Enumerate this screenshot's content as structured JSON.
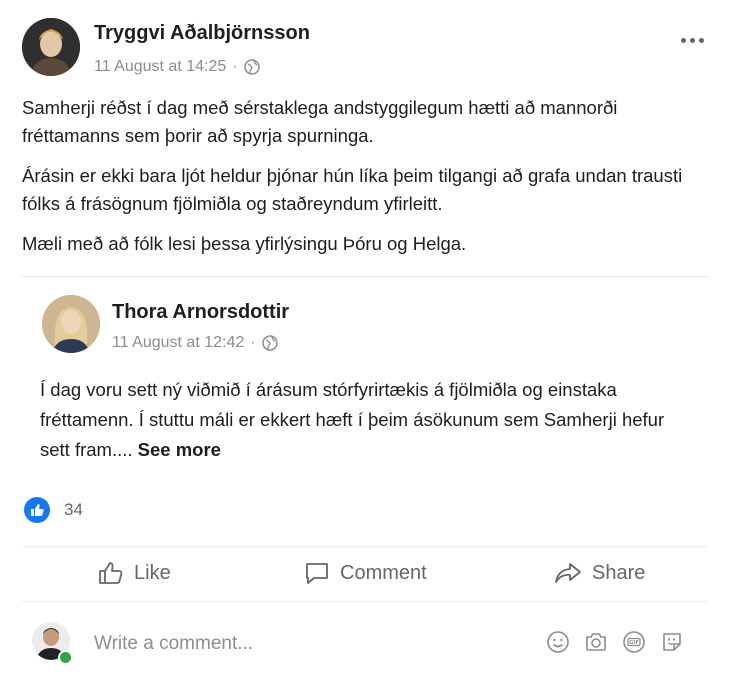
{
  "post": {
    "author": "Tryggvi Aðalbjörnsson",
    "timestamp": "11 August at 14:25",
    "privacy_icon": "globe-icon",
    "paragraphs": [
      "Samherji réðst í dag með sérstaklega andstyggilegum hætti að mannorði fréttamanns sem þorir að spyrja spurninga.",
      "Árásin er ekki bara ljót heldur þjónar hún líka þeim tilgangi að grafa undan trausti fólks á frásögnum fjölmiðla og staðreyndum yfirleitt.",
      "Mæli með að fólk lesi þessa yfirlýsingu Þóru og Helga."
    ]
  },
  "shared": {
    "author": "Thora Arnorsdottir",
    "timestamp": "11 August at 12:42",
    "text": "Í dag voru sett ný viðmið í árásum stórfyrirtækis á fjölmiðla og einstaka fréttamenn. Í stuttu máli er ekkert hæft í þeim ásökunum sem Samherji hefur sett fram....",
    "see_more": "See more"
  },
  "reactions": {
    "count": "34"
  },
  "actions": {
    "like": "Like",
    "comment": "Comment",
    "share": "Share"
  },
  "composer": {
    "placeholder": "Write a comment..."
  },
  "colors": {
    "accent": "#1877f2",
    "muted": "#65676b",
    "online": "#31a24c"
  }
}
